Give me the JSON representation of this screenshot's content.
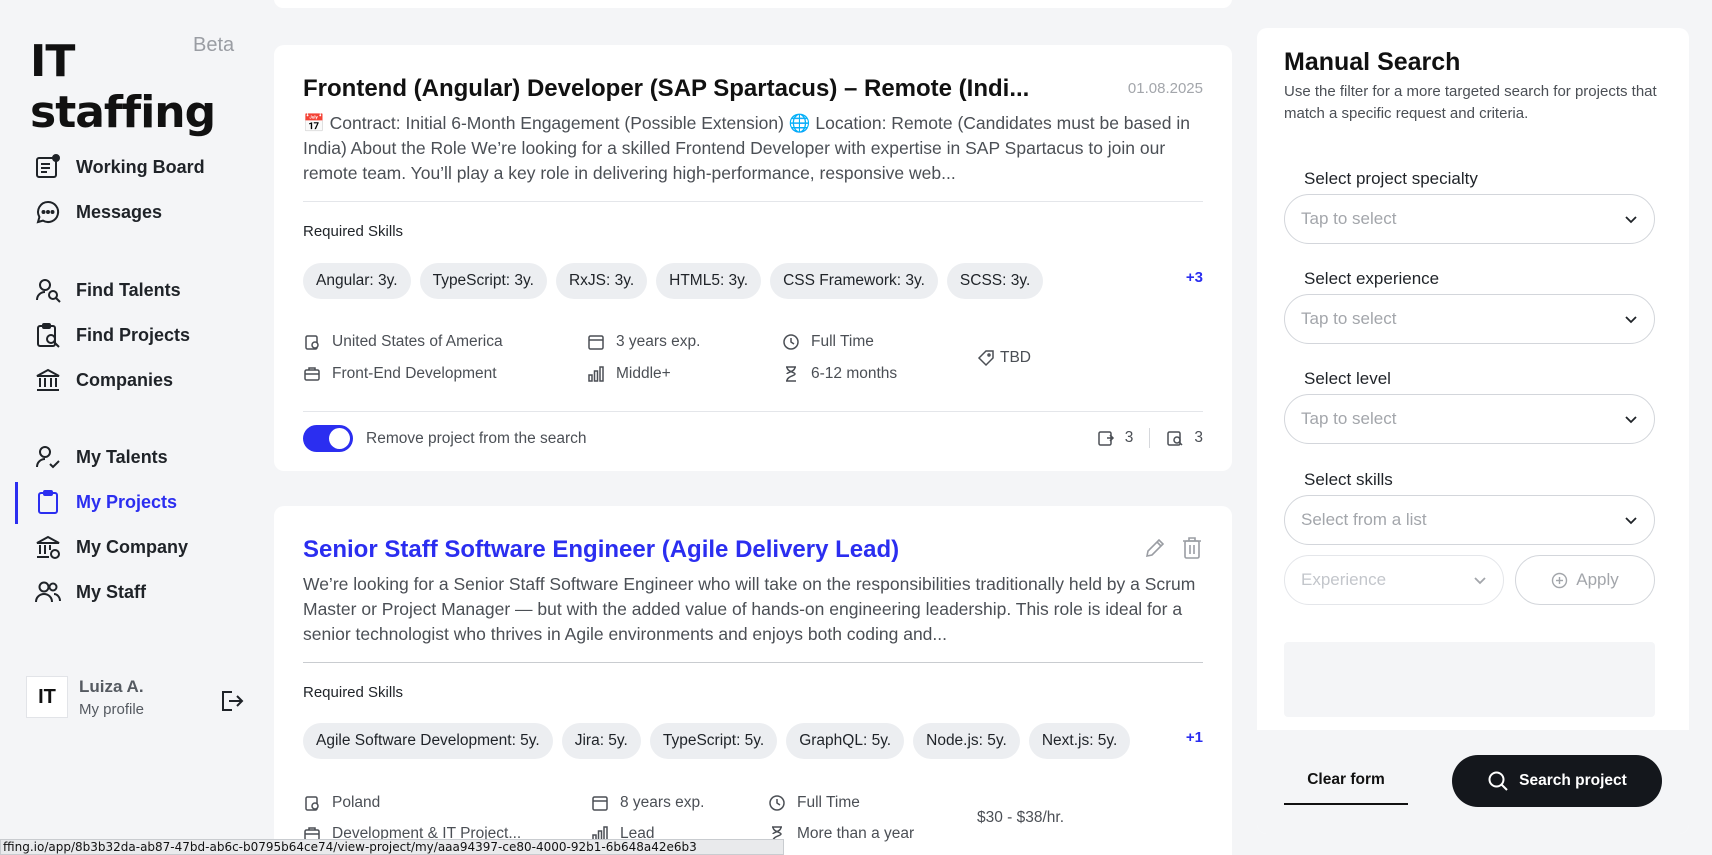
{
  "app": {
    "logo": "IT staffing",
    "beta": "Beta"
  },
  "sidebar": {
    "items": [
      {
        "label": "Working Board"
      },
      {
        "label": "Messages"
      },
      {
        "label": "Find Talents"
      },
      {
        "label": "Find Projects"
      },
      {
        "label": "Companies"
      },
      {
        "label": "My Talents"
      },
      {
        "label": "My Projects"
      },
      {
        "label": "My Company"
      },
      {
        "label": "My Staff"
      }
    ],
    "active_item": "My Projects",
    "profile": {
      "initials": "IT",
      "name": "Luiza A.",
      "link": "My profile"
    }
  },
  "projects": [
    {
      "title": "Frontend (Angular) Developer (SAP Spartacus) – Remote (Indi...",
      "date": "01.08.2025",
      "description": "📅 Contract: Initial 6-Month Engagement (Possible Extension) 🌐 Location: Remote (Candidates must be based in India) About the Role We’re looking for a skilled Frontend Developer with expertise in SAP Spartacus to join our remote team. You’ll play a key role in delivering high-performance, responsive web...",
      "required_skills_label": "Required Skills",
      "skills": [
        "Angular: 3y.",
        "TypeScript: 3y.",
        "RxJS: 3y.",
        "HTML5: 3y.",
        "CSS Framework: 3y.",
        "SCSS: 3y."
      ],
      "more_skills": "+3",
      "country": "United States of America",
      "specialty": "Front-End Development",
      "experience": "3 years exp.",
      "level": "Middle+",
      "employment": "Full Time",
      "duration": "6-12 months",
      "rate": "TBD",
      "toggle_label": "Remove project from the search",
      "toggle_on": true,
      "count_applied": "3",
      "count_viewed": "3"
    },
    {
      "title": "Senior Staff Software Engineer (Agile Delivery Lead)",
      "description": "We’re looking for a Senior Staff Software Engineer who will take on the responsibilities traditionally held by a Scrum Master or Project Manager — but with the added value of hands-on engineering leadership. This role is ideal for a senior technologist who thrives in Agile environments and enjoys both coding and...",
      "required_skills_label": "Required Skills",
      "skills": [
        "Agile Software Development: 5y.",
        "Jira: 5y.",
        "TypeScript: 5y.",
        "GraphQL: 5y.",
        "Node.js: 5y.",
        "Next.js: 5y."
      ],
      "more_skills": "+1",
      "country": "Poland",
      "specialty": "Development & IT Project...",
      "experience": "8 years exp.",
      "level": "Lead",
      "employment": "Full Time",
      "duration": "More than a year",
      "rate": "$30 - $38/hr."
    }
  ],
  "manual_search": {
    "title": "Manual Search",
    "subtitle": "Use the filter for a more targeted search for projects that match a specific request and criteria.",
    "specialty": {
      "label": "Select project specialty",
      "placeholder": "Tap to select"
    },
    "experience": {
      "label": "Select experience",
      "placeholder": "Tap to select"
    },
    "level": {
      "label": "Select level",
      "placeholder": "Tap to select"
    },
    "skills": {
      "label": "Select skills",
      "placeholder": "Select from a list"
    },
    "skill_experience_placeholder": "Experience",
    "apply_label": "Apply",
    "clear_label": "Clear form",
    "search_label": "Search project"
  },
  "statusbar": {
    "url": "ffing.io/app/8b3b32da-ab87-47bd-ab6c-b0795b64ce74/view-project/my/aaa94397-ce80-4000-92b1-6b648a42e6b3"
  },
  "colors": {
    "accent": "#2b2ef0",
    "dark_button": "#14171c",
    "background": "#f4f5f7"
  }
}
